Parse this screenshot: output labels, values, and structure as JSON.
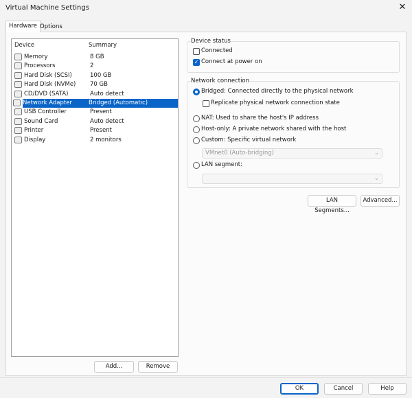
{
  "window": {
    "title": "Virtual Machine Settings",
    "close_icon": "close-icon"
  },
  "tabs": [
    {
      "label": "Hardware",
      "active": true
    },
    {
      "label": "Options",
      "active": false
    }
  ],
  "device_list": {
    "columns": [
      "Device",
      "Summary"
    ],
    "rows": [
      {
        "icon": "memory-icon",
        "device": "Memory",
        "summary": "8 GB"
      },
      {
        "icon": "processor-icon",
        "device": "Processors",
        "summary": "2"
      },
      {
        "icon": "hard-disk-icon",
        "device": "Hard Disk (SCSI)",
        "summary": "100 GB"
      },
      {
        "icon": "hard-disk-icon",
        "device": "Hard Disk (NVMe)",
        "summary": "70 GB"
      },
      {
        "icon": "cd-dvd-icon",
        "device": "CD/DVD (SATA)",
        "summary": "Auto detect"
      },
      {
        "icon": "network-adapter-icon",
        "device": "Network Adapter",
        "summary": "Bridged (Automatic)",
        "selected": true
      },
      {
        "icon": "usb-icon",
        "device": "USB Controller",
        "summary": "Present"
      },
      {
        "icon": "sound-icon",
        "device": "Sound Card",
        "summary": "Auto detect"
      },
      {
        "icon": "printer-icon",
        "device": "Printer",
        "summary": "Present"
      },
      {
        "icon": "display-icon",
        "device": "Display",
        "summary": "2 monitors"
      }
    ],
    "add_label": "Add...",
    "remove_label": "Remove"
  },
  "device_status": {
    "title": "Device status",
    "connected": {
      "label": "Connected",
      "checked": false
    },
    "connect_at_power_on": {
      "label": "Connect at power on",
      "checked": true
    }
  },
  "network_connection": {
    "title": "Network connection",
    "bridged": {
      "label": "Bridged: Connected directly to the physical network",
      "selected": true
    },
    "replicate": {
      "label": "Replicate physical network connection state",
      "checked": false
    },
    "nat": {
      "label": "NAT: Used to share the host's IP address",
      "selected": false
    },
    "host_only": {
      "label": "Host-only: A private network shared with the host",
      "selected": false
    },
    "custom": {
      "label": "Custom: Specific virtual network",
      "selected": false
    },
    "custom_value": "VMnet0 (Auto-bridging)",
    "lan_segment": {
      "label": "LAN segment:",
      "selected": false
    },
    "lan_segment_value": ""
  },
  "buttons": {
    "lan_segments": "LAN Segments...",
    "advanced": "Advanced...",
    "ok": "OK",
    "cancel": "Cancel",
    "help": "Help"
  },
  "colors": {
    "accent": "#0a64c8"
  }
}
